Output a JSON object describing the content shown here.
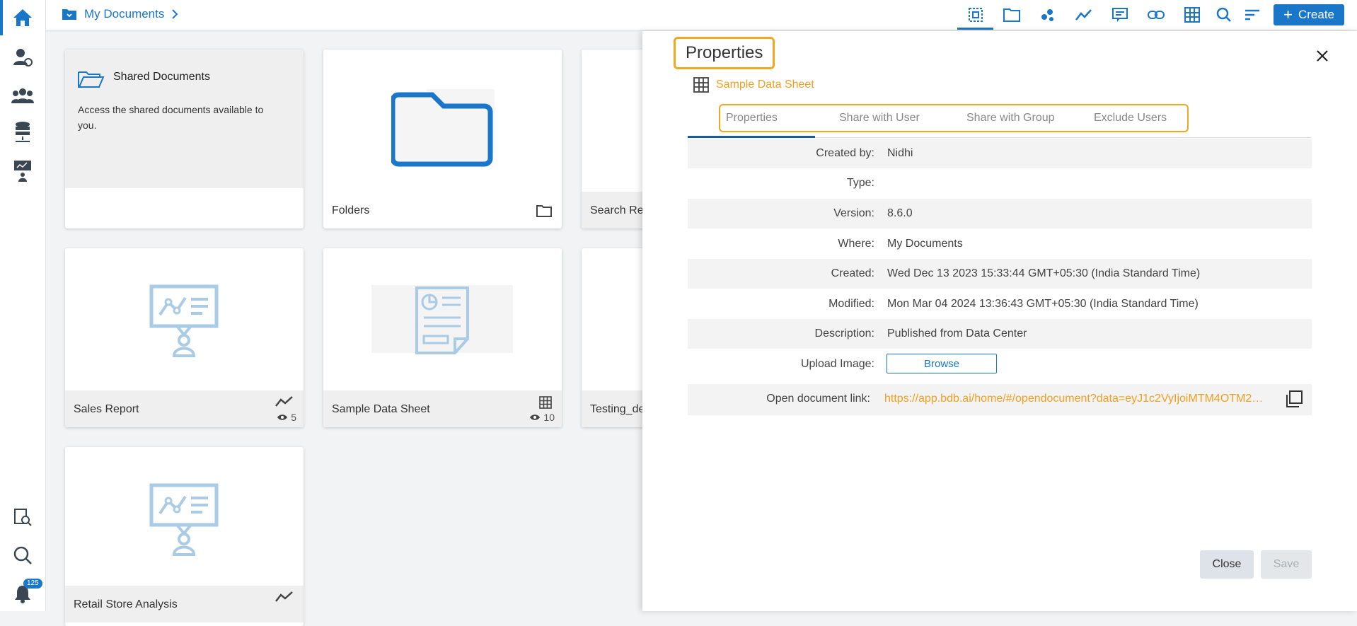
{
  "breadcrumb": {
    "label": "My Documents"
  },
  "topbar": {
    "create_label": "Create"
  },
  "sidebar": {
    "notification_count": "125"
  },
  "cards": [
    {
      "title": "Shared Documents",
      "description": "Access the shared documents available to you."
    },
    {
      "title": "Folders"
    },
    {
      "title": "Search Rep"
    },
    {
      "title": "Sales Report",
      "views": "5"
    },
    {
      "title": "Sample Data Sheet",
      "views": "10"
    },
    {
      "title": "Testing_de"
    },
    {
      "title": "Retail Store Analysis"
    }
  ],
  "panel": {
    "title": "Properties",
    "doc_name": "Sample Data Sheet",
    "tabs": [
      "Properties",
      "Share with User",
      "Share with Group",
      "Exclude Users"
    ],
    "rows": [
      {
        "label": "Created by:",
        "value": "Nidhi"
      },
      {
        "label": "Type:",
        "value": ""
      },
      {
        "label": "Version:",
        "value": "8.6.0"
      },
      {
        "label": "Where:",
        "value": "My Documents"
      },
      {
        "label": "Created:",
        "value": "Wed Dec 13 2023 15:33:44 GMT+05:30 (India Standard Time)"
      },
      {
        "label": "Modified:",
        "value": "Mon Mar 04 2024 13:36:43 GMT+05:30 (India Standard Time)"
      },
      {
        "label": "Description:",
        "value": "Published from Data Center"
      }
    ],
    "upload_label": "Upload Image:",
    "browse_label": "Browse",
    "link_label": "Open document link:",
    "link_value": "https://app.bdb.ai/home/#/opendocument?data=eyJ1c2VyIjoiMTM4OTM2Mz...",
    "close_label": "Close",
    "save_label": "Save"
  },
  "colors": {
    "accent": "#1976c8",
    "highlight": "#f0a820"
  }
}
